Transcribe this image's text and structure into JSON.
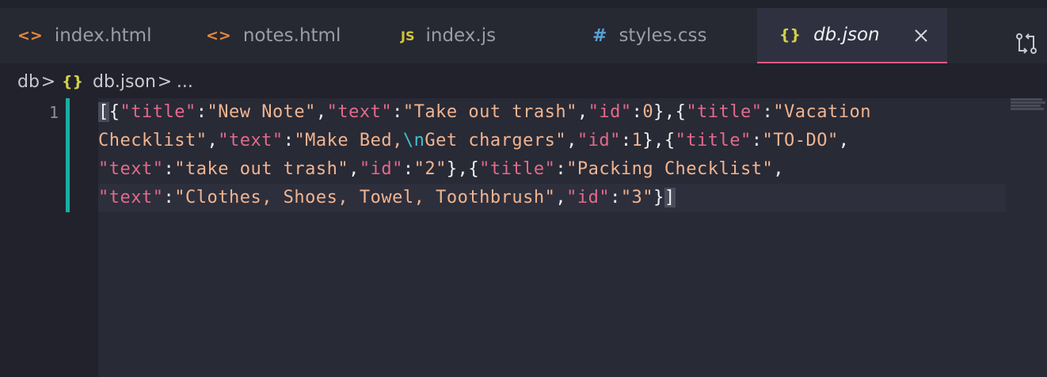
{
  "tabs": [
    {
      "icon": "<>",
      "icon_color": "#e3883d",
      "label": "index.html"
    },
    {
      "icon": "<>",
      "icon_color": "#e3883d",
      "label": "notes.html"
    },
    {
      "icon": "JS",
      "icon_color": "#d4c63a",
      "label": "index.js"
    },
    {
      "icon": "#",
      "icon_color": "#56a2d6",
      "label": "styles.css"
    },
    {
      "icon": "{}",
      "icon_color": "#d4d24a",
      "label": "db.json",
      "active": true
    }
  ],
  "breadcrumb": {
    "folder": "db",
    "separator": ">",
    "file_icon": "{}",
    "file": "db.json",
    "symbol": "..."
  },
  "editor": {
    "line_number": "1",
    "json_text": "[{\"title\":\"New Note\",\"text\":\"Take out trash\",\"id\":0},{\"title\":\"Vacation Checklist\",\"text\":\"Make Bed,\\nGet chargers\",\"id\":1},{\"title\":\"TO-DO\",\"text\":\"take out trash\",\"id\":\"2\"},{\"title\":\"Packing Checklist\",\"text\":\"Clothes, Shoes, Towel, Toothbrush\",\"id\":\"3\"}]"
  },
  "colors": {
    "key": "#e36a8a",
    "string": "#f1b48f",
    "escape": "#3fc2c9",
    "change_bar": "#17b0a4",
    "active_tab_underline": "#e55a82"
  }
}
